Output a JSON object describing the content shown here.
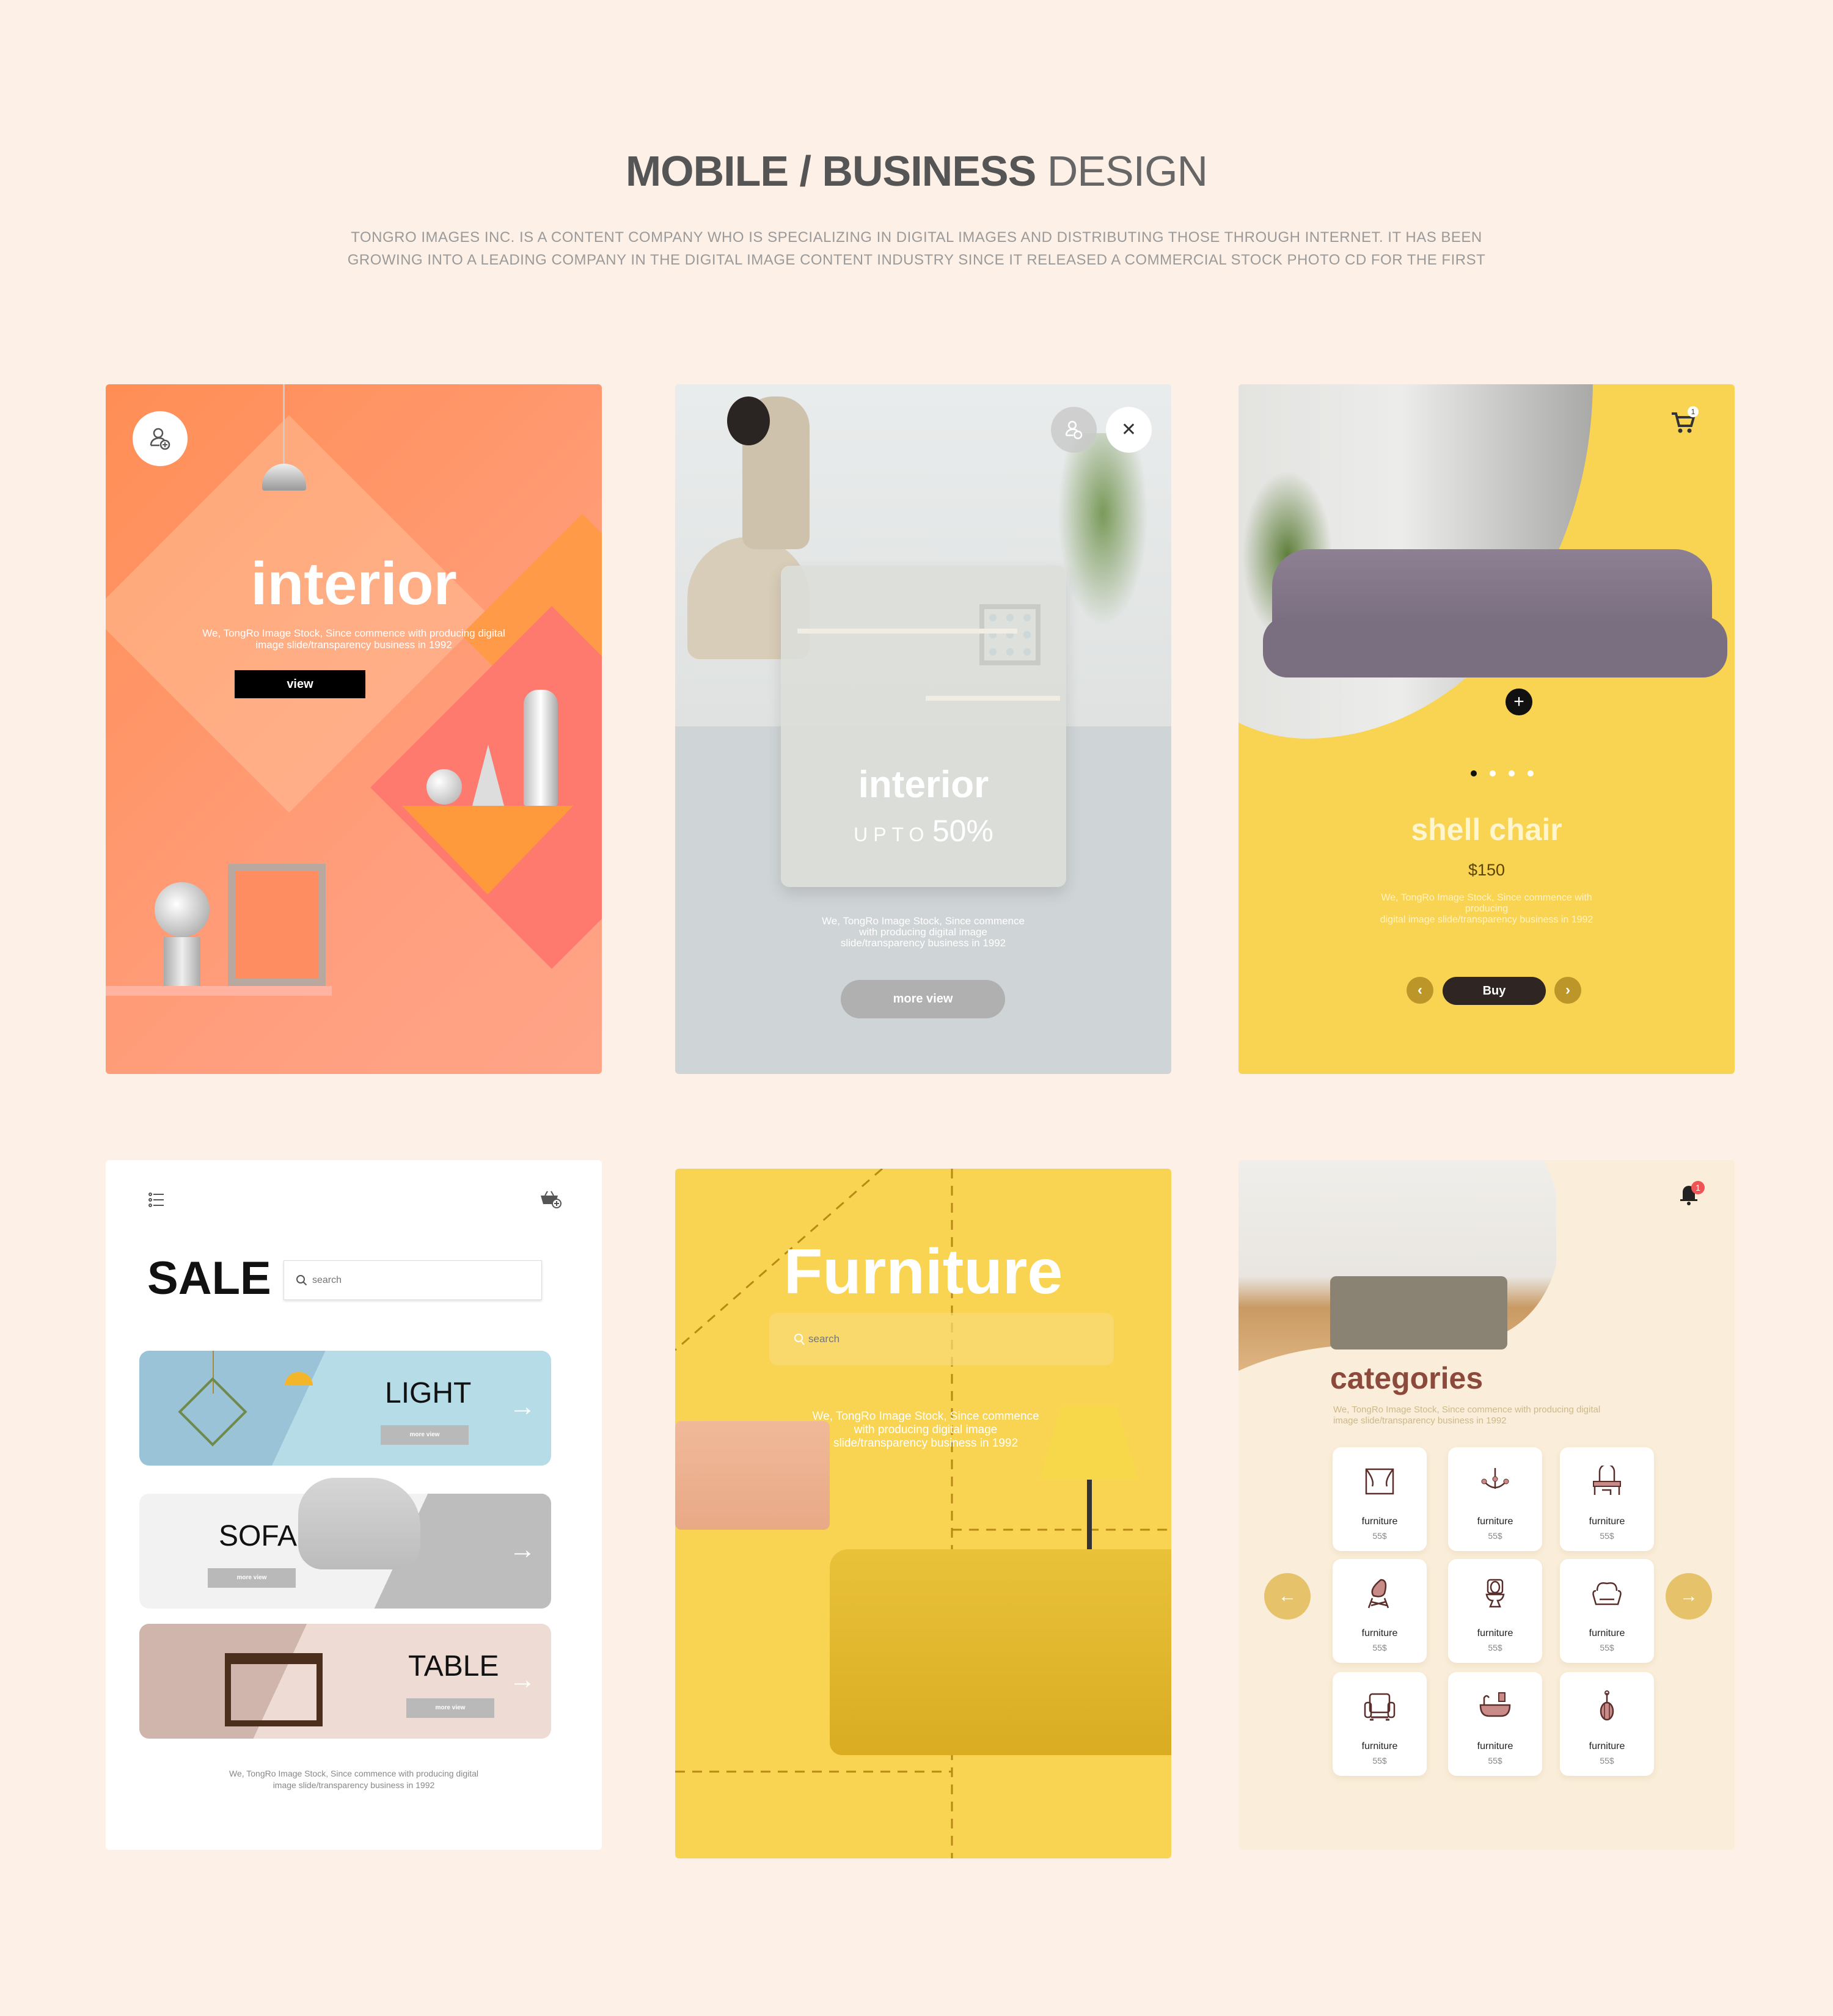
{
  "header": {
    "title_bold": "MOBILE / BUSINESS",
    "title_light": "DESIGN",
    "subtitle_lines": [
      "TONGRO IMAGES INC. IS A CONTENT COMPANY WHO IS SPECIALIZING IN DIGITAL IMAGES AND DISTRIBUTING THOSE THROUGH INTERNET. IT HAS BEEN",
      "GROWING INTO A LEADING COMPANY IN THE DIGITAL IMAGE CONTENT INDUSTRY SINCE IT RELEASED A COMMERCIAL STOCK PHOTO CD FOR THE FIRST"
    ]
  },
  "colors": {
    "background": "#fdf0e7",
    "orange": "#ff8e55",
    "yellow": "#f9d452",
    "gray": "#cfd4d6",
    "cream": "#faeeda",
    "brown": "#8b4a3c",
    "dark": "#2f2522"
  },
  "card1": {
    "icon": "user-plus-icon",
    "title": "interior",
    "desc_lines": [
      "We, TongRo Image Stock, Since commence with producing digital",
      "image slide/transparency business in 1992"
    ],
    "button": "view"
  },
  "card2": {
    "icons": [
      "user-plus-icon",
      "close-icon"
    ],
    "title": "interior",
    "upto": "UPTO",
    "discount": "50%",
    "desc_lines": [
      "We, TongRo Image Stock, Since commence",
      "with producing digital image",
      "slide/transparency business in 1992"
    ],
    "button": "more view"
  },
  "card3": {
    "cart_badge": "1",
    "title": "shell chair",
    "price": "$150",
    "desc_lines": [
      "We, TongRo Image Stock, Since commence with producing",
      "digital image slide/transparency business in 1992"
    ],
    "button": "Buy",
    "carousel_active": 1,
    "carousel_count": 4
  },
  "card4": {
    "title": "SALE",
    "search_placeholder": "search",
    "banners": [
      {
        "label": "LIGHT",
        "button": "more view"
      },
      {
        "label": "SOFA",
        "button": "more view"
      },
      {
        "label": "TABLE",
        "button": "more view"
      }
    ],
    "desc_lines": [
      "We, TongRo Image Stock, Since commence with producing digital",
      "image slide/transparency business in 1992"
    ]
  },
  "card5": {
    "title": "Furniture",
    "search_placeholder": "search",
    "desc_lines": [
      "We, TongRo Image Stock, Since commence",
      "with producing digital image",
      "slide/transparency business in 1992"
    ]
  },
  "card6": {
    "bell_badge": "1",
    "title": "categories",
    "desc_lines": [
      "We, TongRo Image Stock, Since commence with producing digital",
      "image slide/transparency business in 1992"
    ],
    "items": [
      {
        "icon": "curtains-icon",
        "name": "furniture",
        "price": "55$"
      },
      {
        "icon": "chandelier-icon",
        "name": "furniture",
        "price": "55$"
      },
      {
        "icon": "vanity-icon",
        "name": "furniture",
        "price": "55$"
      },
      {
        "icon": "chair-icon",
        "name": "furniture",
        "price": "55$"
      },
      {
        "icon": "toilet-icon",
        "name": "furniture",
        "price": "55$"
      },
      {
        "icon": "armchair-icon",
        "name": "furniture",
        "price": "55$"
      },
      {
        "icon": "sofa-chair-icon",
        "name": "furniture",
        "price": "55$"
      },
      {
        "icon": "bathtub-icon",
        "name": "furniture",
        "price": "55$"
      },
      {
        "icon": "pendant-lamp-icon",
        "name": "furniture",
        "price": "55$"
      }
    ]
  }
}
